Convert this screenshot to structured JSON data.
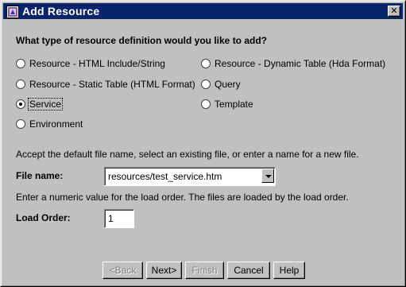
{
  "window": {
    "title": "Add Resource",
    "close_glyph": "✕"
  },
  "question": "What type of resource definition would you like to add?",
  "resource_types": [
    {
      "label": "Resource - HTML Include/String",
      "selected": false
    },
    {
      "label": "Resource - Static Table (HTML Format)",
      "selected": false
    },
    {
      "label": "Service",
      "selected": true
    },
    {
      "label": "Environment",
      "selected": false
    },
    {
      "label": "Resource - Dynamic Table (Hda Format)",
      "selected": false
    },
    {
      "label": "Query",
      "selected": false
    },
    {
      "label": "Template",
      "selected": false
    }
  ],
  "file_instruction": "Accept the default file name, select an existing file, or enter a name for a new file.",
  "file_name": {
    "label": "File name:",
    "value": "resources/test_service.htm"
  },
  "load_instruction": "Enter a numeric value for the load order. The files are loaded by the load order.",
  "load_order": {
    "label": "Load Order:",
    "value": "1"
  },
  "buttons": {
    "back": "<Back",
    "next": "Next>",
    "finish": "Finish",
    "cancel": "Cancel",
    "help": "Help"
  },
  "icons": {
    "app": "app-window-icon",
    "close": "close-icon",
    "dropdown": "chevron-down-icon"
  },
  "colors": {
    "titlebar": "#0a246a",
    "face": "#c0c0c0"
  }
}
